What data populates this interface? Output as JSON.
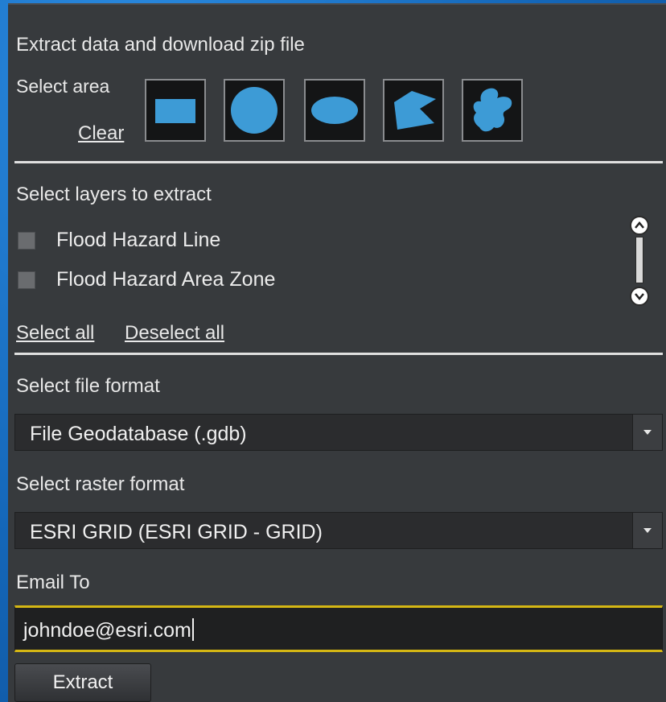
{
  "panel": {
    "title": "Extract data and download zip file"
  },
  "select_area": {
    "label": "Select area",
    "clear_label": "Clear",
    "tools": [
      {
        "name": "rectangle-icon"
      },
      {
        "name": "circle-icon"
      },
      {
        "name": "ellipse-icon"
      },
      {
        "name": "polygon-icon"
      },
      {
        "name": "freehand-polygon-icon"
      }
    ],
    "shape_fill": "#3d9bd6"
  },
  "layers": {
    "label": "Select layers to extract",
    "items": [
      {
        "label": "Flood Hazard Line",
        "checked": false
      },
      {
        "label": "Flood Hazard Area Zone",
        "checked": false
      }
    ],
    "select_all": "Select all",
    "deselect_all": "Deselect all"
  },
  "file_format": {
    "label": "Select file format",
    "value": "File Geodatabase (.gdb)"
  },
  "raster_format": {
    "label": "Select raster format",
    "value": "ESRI GRID (ESRI GRID - GRID)"
  },
  "email": {
    "label": "Email To",
    "value": "johndoe@esri.com"
  },
  "actions": {
    "extract_label": "Extract"
  },
  "colors": {
    "panel_bg": "#373a3d",
    "accent_focus": "#d4b614",
    "frame_blue": "#1a73c4"
  }
}
